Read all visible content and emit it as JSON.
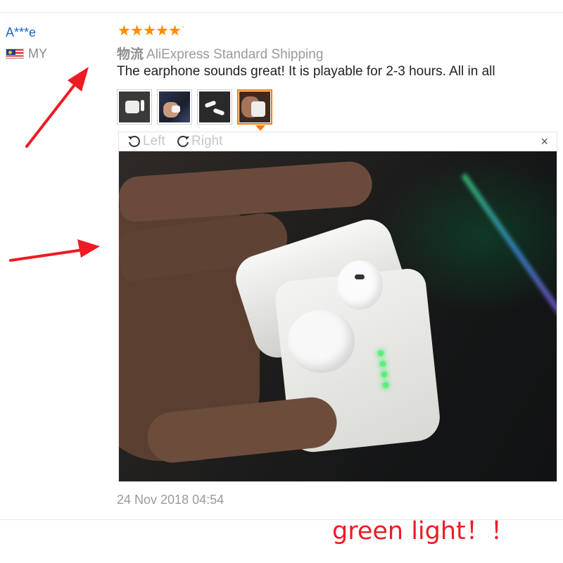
{
  "review": {
    "buyer_name": "A***e",
    "country_code": "MY",
    "rating": 5,
    "shipping_label": "物流",
    "shipping_method": "AliExpress Standard Shipping",
    "text": "The earphone sounds great! It is playable for 2-3 hours. All in all",
    "date": "24 Nov 2018 04:54"
  },
  "thumbnails": [
    {
      "name": "thumb-1",
      "active": false
    },
    {
      "name": "thumb-2",
      "active": false
    },
    {
      "name": "thumb-3",
      "active": false
    },
    {
      "name": "thumb-4",
      "active": true
    }
  ],
  "viewer": {
    "rotate_left_label": "Left",
    "rotate_right_label": "Right",
    "close_symbol": "×"
  },
  "annotation": {
    "text": "green light！！",
    "color": "#ee1b24"
  },
  "icons": [
    "star-icon",
    "flag-icon",
    "rotate-left-icon",
    "rotate-right-icon",
    "close-icon"
  ]
}
